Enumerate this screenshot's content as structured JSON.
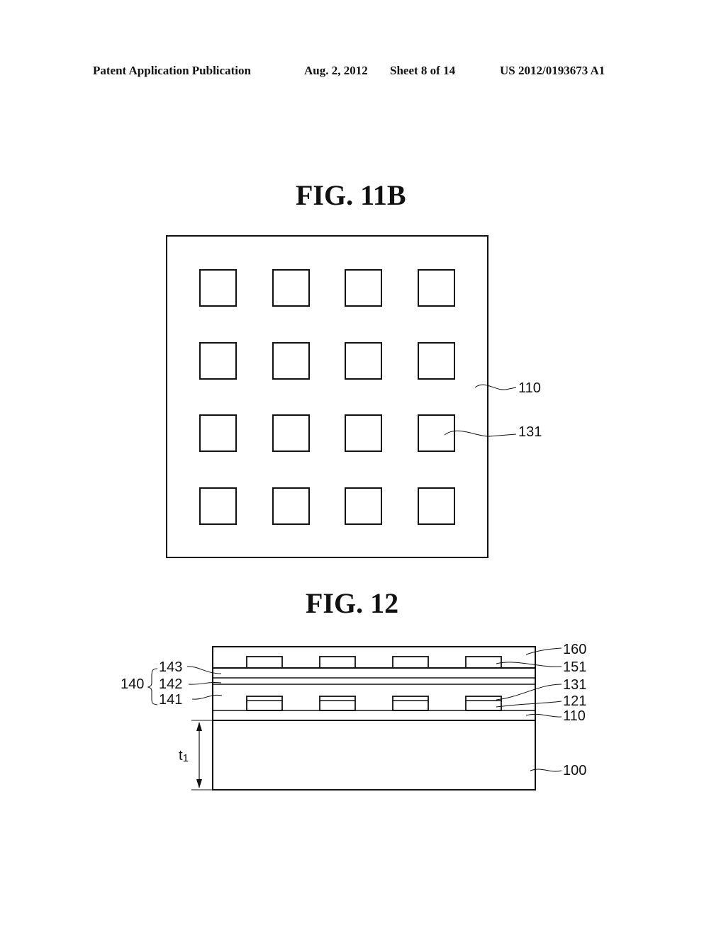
{
  "header": {
    "publication": "Patent Application Publication",
    "date": "Aug. 2, 2012",
    "sheet": "Sheet 8 of 14",
    "number": "US 2012/0193673 A1"
  },
  "fig11b": {
    "title": "FIG. 11B",
    "grid_rows": 4,
    "grid_cols": 4,
    "labels": {
      "substrate": "110",
      "pattern": "131"
    }
  },
  "fig12": {
    "title": "FIG. 12",
    "pattern_count": 4,
    "labels": {
      "l160": "160",
      "l151": "151",
      "l131": "131",
      "l121": "121",
      "l110": "110",
      "l100": "100",
      "l140": "140",
      "l143": "143",
      "l142": "142",
      "l141": "141",
      "thickness": "t",
      "thickness_sub": "1"
    }
  }
}
